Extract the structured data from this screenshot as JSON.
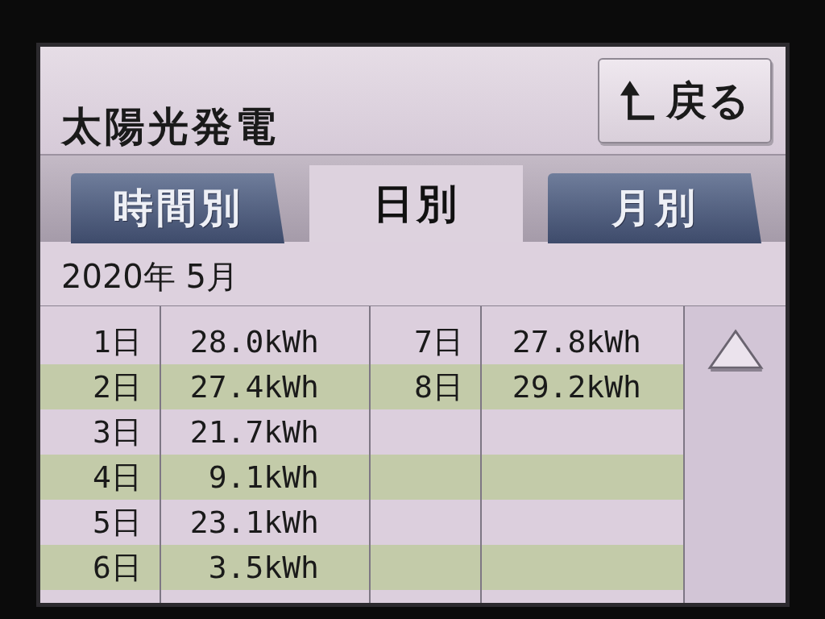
{
  "screen": {
    "title": "太陽光発電",
    "back_button": {
      "label": "戻る"
    }
  },
  "tabs": [
    {
      "label": "時間別",
      "selected": false
    },
    {
      "label": "日別",
      "selected": true
    },
    {
      "label": "月別",
      "selected": false
    }
  ],
  "period": "2020年 5月",
  "table": {
    "columns": [
      {
        "rows": [
          {
            "day": "1日",
            "energy": "28.0kWh"
          },
          {
            "day": "2日",
            "energy": "27.4kWh"
          },
          {
            "day": "3日",
            "energy": "21.7kWh"
          },
          {
            "day": "4日",
            "energy": "9.1kWh"
          },
          {
            "day": "5日",
            "energy": "23.1kWh"
          },
          {
            "day": "6日",
            "energy": "3.5kWh"
          }
        ]
      },
      {
        "rows": [
          {
            "day": "7日",
            "energy": "27.8kWh"
          },
          {
            "day": "8日",
            "energy": "29.2kWh"
          }
        ]
      }
    ]
  }
}
